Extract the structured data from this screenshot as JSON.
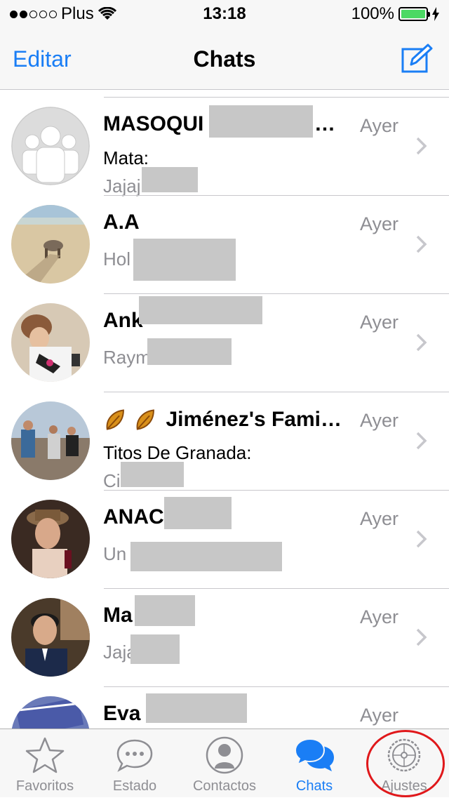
{
  "status_bar": {
    "carrier": "Plus",
    "time": "13:18",
    "battery": "100%",
    "battery_color": "#4cd964"
  },
  "nav": {
    "edit_label": "Editar",
    "title": "Chats"
  },
  "chats": [
    {
      "name": "MASOQUI",
      "name_suffix": "…",
      "time": "Ayer",
      "sender": "Mata:",
      "preview": "Jajaj"
    },
    {
      "name": "A.A",
      "time": "Ayer",
      "preview": "Hol"
    },
    {
      "name": "Ank",
      "time": "Ayer",
      "preview": "Raym"
    },
    {
      "name": "Jiménez's Fami…",
      "time": "Ayer",
      "sender": "Titos De Granada:",
      "preview": "Ci"
    },
    {
      "name": "ANAC",
      "time": "Ayer",
      "preview": "Un"
    },
    {
      "name": "Ma",
      "time": "Ayer",
      "preview": "Jaja"
    },
    {
      "name": "Eva",
      "time": "Ayer"
    }
  ],
  "tabs": [
    {
      "label": "Favoritos",
      "icon": "star-icon"
    },
    {
      "label": "Estado",
      "icon": "speech-bubble-icon"
    },
    {
      "label": "Contactos",
      "icon": "person-icon"
    },
    {
      "label": "Chats",
      "icon": "chat-bubbles-icon",
      "active": true
    },
    {
      "label": "Ajustes",
      "icon": "gear-icon"
    }
  ],
  "colors": {
    "accent": "#1a7ef5",
    "highlight": "#e0181b"
  }
}
